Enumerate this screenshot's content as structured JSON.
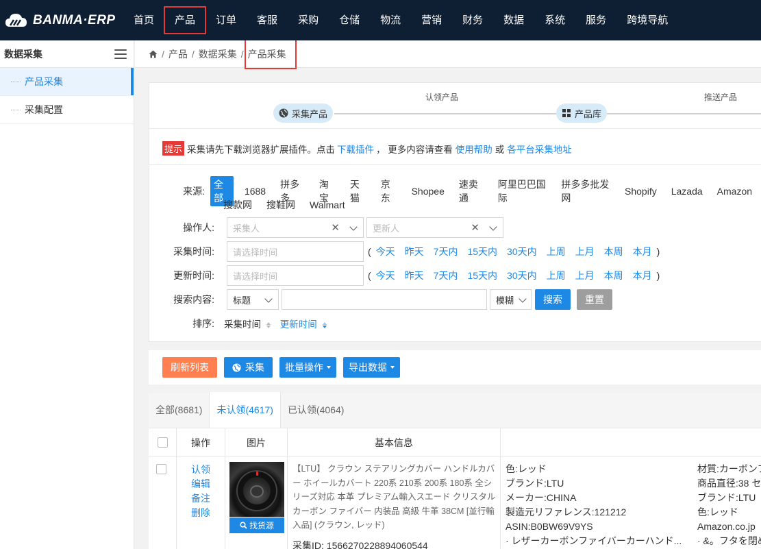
{
  "app": {
    "logo_text": "BANMA·ERP"
  },
  "nav": {
    "items": [
      "首页",
      "产品",
      "订单",
      "客服",
      "采购",
      "仓储",
      "物流",
      "营销",
      "财务",
      "数据",
      "系统",
      "服务",
      "跨境导航"
    ]
  },
  "sidebar": {
    "title": "数据采集",
    "items": [
      {
        "label": "产品采集"
      },
      {
        "label": "采集配置"
      }
    ]
  },
  "breadcrumb": [
    "产品",
    "数据采集",
    "产品采集"
  ],
  "steps": {
    "step1": "采集产品",
    "step2": "产品库",
    "label1": "认领产品",
    "label2": "推送产品"
  },
  "tip": {
    "badge": "提示",
    "text1": "采集请先下载浏览器扩展插件。点击",
    "link1": "下载插件",
    "text2": "，  更多内容请查看",
    "link2": "使用帮助",
    "text3": "或",
    "link3": "各平台采集地址"
  },
  "filter": {
    "source_label": "来源:",
    "sources": [
      "全部",
      "1688",
      "拼多多",
      "淘宝",
      "天猫",
      "京东",
      "Shopee",
      "速卖通",
      "阿里巴巴国际",
      "拼多多批发网",
      "Shopify",
      "Lazada",
      "Amazon"
    ],
    "sources_row2": [
      "搜款网",
      "搜鞋网",
      "Walmart"
    ],
    "operator_label": "操作人:",
    "collector_placeholder": "采集人",
    "updater_placeholder": "更新人",
    "collect_time_label": "采集时间:",
    "update_time_label": "更新时间:",
    "time_placeholder": "请选择时间",
    "quick_times": [
      "今天",
      "昨天",
      "7天内",
      "15天内",
      "30天内",
      "上周",
      "上月",
      "本周",
      "本月"
    ],
    "paren_open": "(",
    "paren_close": ")",
    "search_label": "搜索内容:",
    "search_field": "标题",
    "match_mode": "模糊",
    "search_button": "搜索",
    "reset_button": "重置",
    "sort_label": "排序:",
    "sort_options": [
      "采集时间",
      "更新时间"
    ]
  },
  "actions": {
    "refresh": "刷新列表",
    "collect": "采集",
    "batch": "批量操作",
    "export": "导出数据"
  },
  "tabs": [
    "全部(8681)",
    "未认领(4617)",
    "已认领(4064)"
  ],
  "table": {
    "headers": {
      "op": "操作",
      "image": "图片",
      "info": "基本信息"
    },
    "row": {
      "ops": [
        "认领",
        "编辑",
        "备注",
        "删除"
      ],
      "find_source": "找货源",
      "title": "【LTU】 クラウン ステアリングカバー ハンドルカバー ホイールカバート 220系 210系 200系 180系 全シリーズ対応 本革 プレミアム輸入スエード クリスタル カーボン ファイバー 内装品 高級 牛革 38CM [並行輸入品] (クラウン, レッド)",
      "collect_id": "采集ID:  1566270228894060544",
      "source_id": "B0BW69V9YS",
      "attrs_left": [
        "色:レッド",
        "ブランド:LTU",
        "メーカー:CHINA",
        "製造元リファレンス:121212",
        "ASIN:B0BW69V9YS",
        "· レザーカーボンファイバーカーハンド..."
      ],
      "attrs_right": [
        "材質:カーボンフ",
        "商品直径:38 セ",
        "ブランド:LTU",
        "色:レッド",
        "Amazon.co.jp",
        "· &。フタを閉め"
      ]
    }
  },
  "colors": {
    "nav_bg": "#0e1e33",
    "primary": "#1e88e5",
    "highlight_red": "#e53935",
    "refresh_btn": "#ff7f50",
    "reset_btn": "#9e9e9e"
  }
}
